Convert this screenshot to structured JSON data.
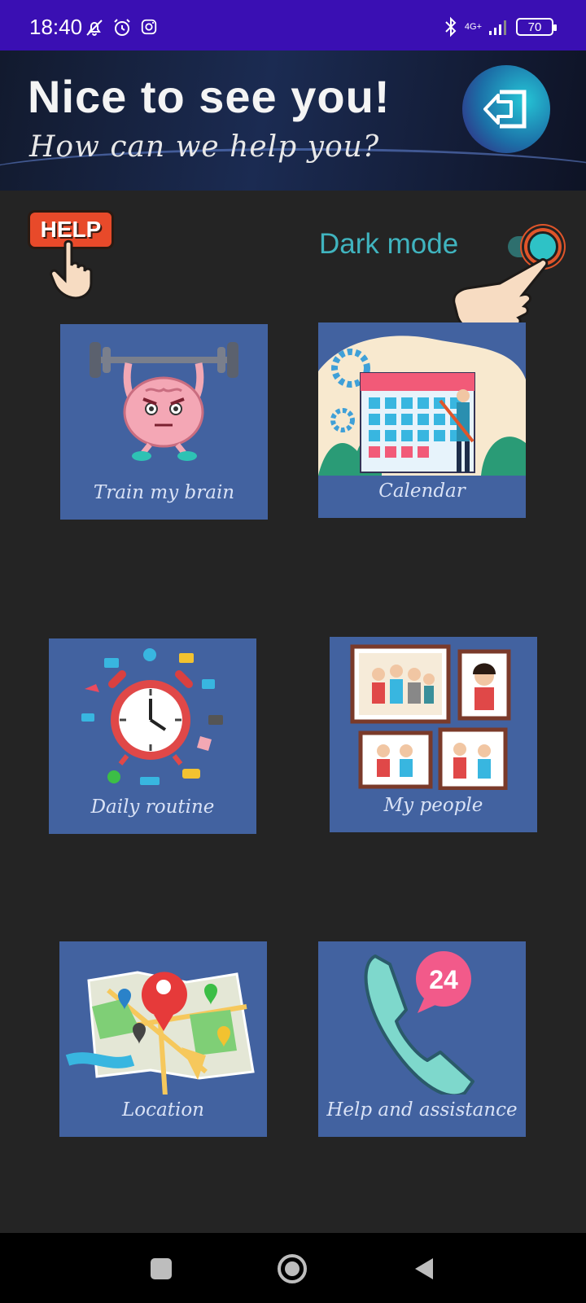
{
  "status": {
    "time": "18:40",
    "icons": [
      "bell-off-icon",
      "alarm-icon",
      "instagram-icon"
    ],
    "right_icons": [
      "bluetooth-icon",
      "signal-icon"
    ],
    "network": "4G+",
    "battery": "70"
  },
  "banner": {
    "greeting": "Nice to see you!",
    "subtitle": "How can we help you?",
    "logout_icon": "logout-icon"
  },
  "help": {
    "label": "HELP"
  },
  "dark_mode": {
    "label": "Dark mode",
    "enabled": true
  },
  "tiles": [
    {
      "label": "Train my brain",
      "icon": "brain-lifting-icon"
    },
    {
      "label": "Calendar",
      "icon": "calendar-icon"
    },
    {
      "label": "Daily routine",
      "icon": "clock-routine-icon"
    },
    {
      "label": "My people",
      "icon": "family-photos-icon"
    },
    {
      "label": "Location",
      "icon": "map-icon"
    },
    {
      "label": "Help and assistance",
      "icon": "phone-24-icon"
    }
  ],
  "nav": [
    "recents-button",
    "home-button",
    "back-button"
  ],
  "colors": {
    "status_bar": "#3a0fb3",
    "background": "#242424",
    "tile": "#4262a0",
    "accent": "#40b4bf",
    "help": "#e84a2a"
  }
}
